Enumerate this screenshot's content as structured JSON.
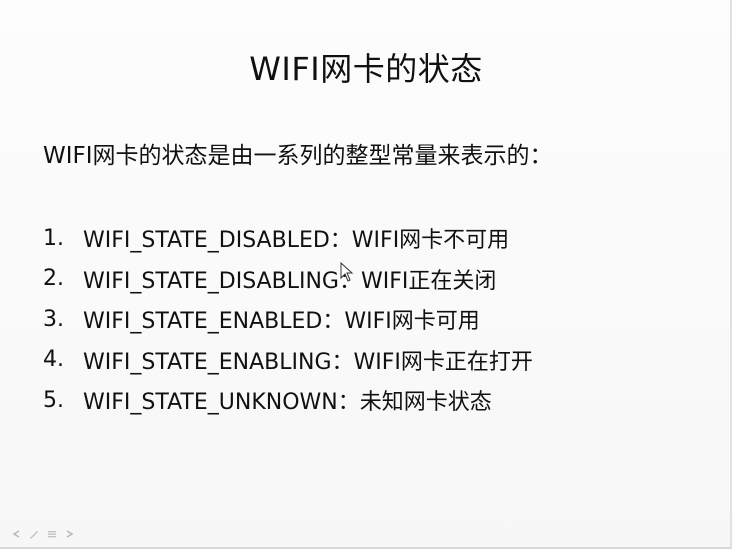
{
  "slide": {
    "title": "WIFI网卡的状态",
    "intro": "WIFI网卡的状态是由一系列的整型常量来表示的：",
    "items": [
      {
        "number": "1.",
        "text": "WIFI_STATE_DISABLED：WIFI网卡不可用"
      },
      {
        "number": "2.",
        "text": "WIFI_STATE_DISABLING：WIFI正在关闭"
      },
      {
        "number": "3.",
        "text": "WIFI_STATE_ENABLED：WIFI网卡可用"
      },
      {
        "number": "4.",
        "text": "WIFI_STATE_ENABLING：WIFI网卡正在打开"
      },
      {
        "number": "5.",
        "text": "WIFI_STATE_UNKNOWN：未知网卡状态"
      }
    ]
  },
  "toolbar": {
    "icons": [
      "back-arrow-icon",
      "pen-icon",
      "menu-icon",
      "forward-arrow-icon"
    ]
  }
}
